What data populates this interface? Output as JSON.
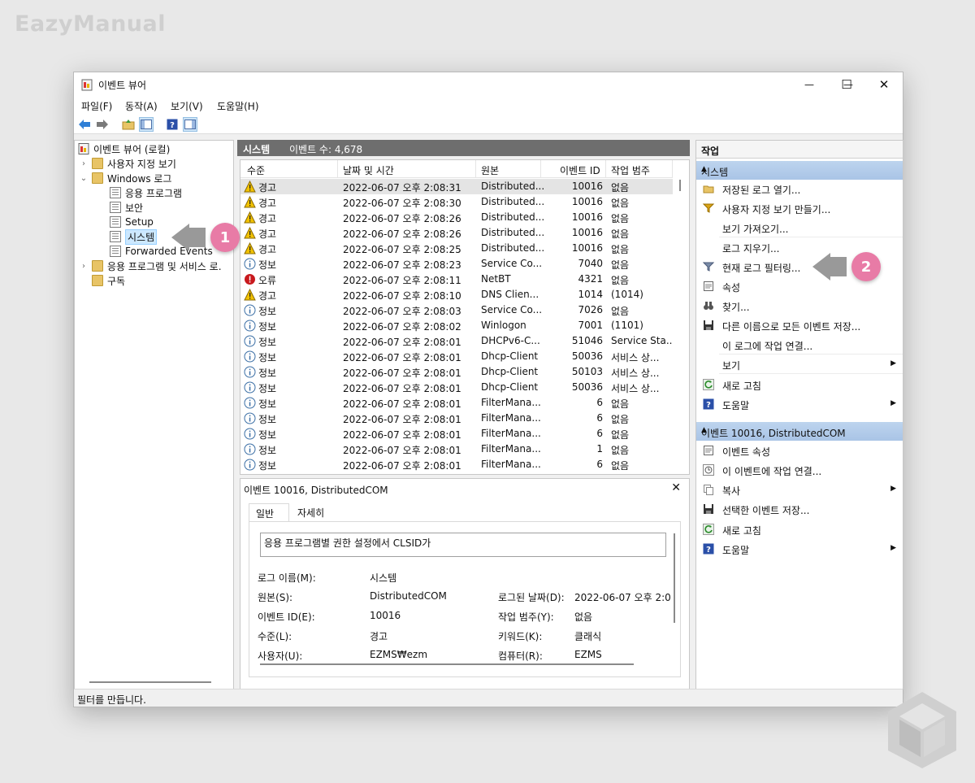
{
  "brand": "EazyManual",
  "window": {
    "title": "이벤트 뷰어",
    "controls": {
      "minimize": "—",
      "maximize": "☐",
      "close": "✕"
    }
  },
  "menu": [
    "파일(F)",
    "동작(A)",
    "보기(V)",
    "도움말(H)"
  ],
  "toolbar": [
    "back-icon",
    "forward-icon",
    "up-folder-icon",
    "console-tree-icon",
    "help-icon",
    "action-pane-icon"
  ],
  "tree": {
    "root": "이벤트 뷰어 (로컬)",
    "custom_views": "사용자 지정 보기",
    "windows_logs": "Windows 로그",
    "application": "응용 프로그램",
    "security": "보안",
    "setup": "Setup",
    "system": "시스템",
    "forwarded": "Forwarded Events",
    "app_service_logs": "응용 프로그램 및 서비스 로.",
    "subscriptions": "구독"
  },
  "center": {
    "title": "시스템",
    "count_label": "이벤트 수: 4,678",
    "columns": [
      "수준",
      "날짜 및 시간",
      "원본",
      "이벤트 ID",
      "작업 범주"
    ],
    "rows": [
      {
        "level": "경고",
        "kind": "warn",
        "datetime": "2022-06-07 오후 2:08:31",
        "source": "Distributed...",
        "id": "10016",
        "category": "없음"
      },
      {
        "level": "경고",
        "kind": "warn",
        "datetime": "2022-06-07 오후 2:08:30",
        "source": "Distributed...",
        "id": "10016",
        "category": "없음"
      },
      {
        "level": "경고",
        "kind": "warn",
        "datetime": "2022-06-07 오후 2:08:26",
        "source": "Distributed...",
        "id": "10016",
        "category": "없음"
      },
      {
        "level": "경고",
        "kind": "warn",
        "datetime": "2022-06-07 오후 2:08:26",
        "source": "Distributed...",
        "id": "10016",
        "category": "없음"
      },
      {
        "level": "경고",
        "kind": "warn",
        "datetime": "2022-06-07 오후 2:08:25",
        "source": "Distributed...",
        "id": "10016",
        "category": "없음"
      },
      {
        "level": "정보",
        "kind": "info",
        "datetime": "2022-06-07 오후 2:08:23",
        "source": "Service Co...",
        "id": "7040",
        "category": "없음"
      },
      {
        "level": "오류",
        "kind": "error",
        "datetime": "2022-06-07 오후 2:08:11",
        "source": "NetBT",
        "id": "4321",
        "category": "없음"
      },
      {
        "level": "경고",
        "kind": "warn",
        "datetime": "2022-06-07 오후 2:08:10",
        "source": "DNS Clien...",
        "id": "1014",
        "category": "(1014)"
      },
      {
        "level": "정보",
        "kind": "info",
        "datetime": "2022-06-07 오후 2:08:03",
        "source": "Service Co...",
        "id": "7026",
        "category": "없음"
      },
      {
        "level": "정보",
        "kind": "info",
        "datetime": "2022-06-07 오후 2:08:02",
        "source": "Winlogon",
        "id": "7001",
        "category": "(1101)"
      },
      {
        "level": "정보",
        "kind": "info",
        "datetime": "2022-06-07 오후 2:08:01",
        "source": "DHCPv6-C...",
        "id": "51046",
        "category": "Service Sta..."
      },
      {
        "level": "정보",
        "kind": "info",
        "datetime": "2022-06-07 오후 2:08:01",
        "source": "Dhcp-Client",
        "id": "50036",
        "category": "서비스 상..."
      },
      {
        "level": "정보",
        "kind": "info",
        "datetime": "2022-06-07 오후 2:08:01",
        "source": "Dhcp-Client",
        "id": "50103",
        "category": "서비스 상..."
      },
      {
        "level": "정보",
        "kind": "info",
        "datetime": "2022-06-07 오후 2:08:01",
        "source": "Dhcp-Client",
        "id": "50036",
        "category": "서비스 상..."
      },
      {
        "level": "정보",
        "kind": "info",
        "datetime": "2022-06-07 오후 2:08:01",
        "source": "FilterMana...",
        "id": "6",
        "category": "없음"
      },
      {
        "level": "정보",
        "kind": "info",
        "datetime": "2022-06-07 오후 2:08:01",
        "source": "FilterMana...",
        "id": "6",
        "category": "없음"
      },
      {
        "level": "정보",
        "kind": "info",
        "datetime": "2022-06-07 오후 2:08:01",
        "source": "FilterMana...",
        "id": "6",
        "category": "없음"
      },
      {
        "level": "정보",
        "kind": "info",
        "datetime": "2022-06-07 오후 2:08:01",
        "source": "FilterMana...",
        "id": "1",
        "category": "없음"
      },
      {
        "level": "정보",
        "kind": "info",
        "datetime": "2022-06-07 오후 2:08:01",
        "source": "FilterMana...",
        "id": "6",
        "category": "없음"
      }
    ]
  },
  "detail": {
    "title": "이벤트 10016, DistributedCOM",
    "close": "✕",
    "tabs": [
      "일반",
      "자세히"
    ],
    "message": "응용 프로그램별 권한 설정에서 CLSID가",
    "fields": {
      "log_name_label": "로그 이름(M):",
      "log_name": "시스템",
      "source_label": "원본(S):",
      "source": "DistributedCOM",
      "logged_label": "로그된 날짜(D):",
      "logged": "2022-06-07 오후 2:0",
      "event_id_label": "이벤트 ID(E):",
      "event_id": "10016",
      "task_label": "작업 범주(Y):",
      "task": "없음",
      "level_label": "수준(L):",
      "level": "경고",
      "keywords_label": "키워드(K):",
      "keywords": "클래식",
      "user_label": "사용자(U):",
      "user": "EZMS₩ezm",
      "computer_label": "컴퓨터(R):",
      "computer": "EZMS"
    }
  },
  "actions": {
    "header": "작업",
    "section1": "시스템",
    "items1": [
      "저장된 로그 열기...",
      "사용자 지정 보기 만들기...",
      "보기 가져오기...",
      "로그 지우기...",
      "현재 로그 필터링...",
      "속성",
      "찾기...",
      "다른 이름으로 모든 이벤트 저장...",
      "이 로그에 작업 연결...",
      "보기",
      "새로 고침",
      "도움말"
    ],
    "section2": "이벤트 10016, DistributedCOM",
    "items2": [
      "이벤트 속성",
      "이 이벤트에 작업 연결...",
      "복사",
      "선택한 이벤트 저장...",
      "새로 고침",
      "도움말"
    ]
  },
  "status": "필터를 만듭니다.",
  "callouts": [
    "1",
    "2"
  ],
  "colors": {
    "accent_section": "#b3cdeb",
    "callout": "#e87ba6",
    "header_bar": "#6e6e6e"
  }
}
